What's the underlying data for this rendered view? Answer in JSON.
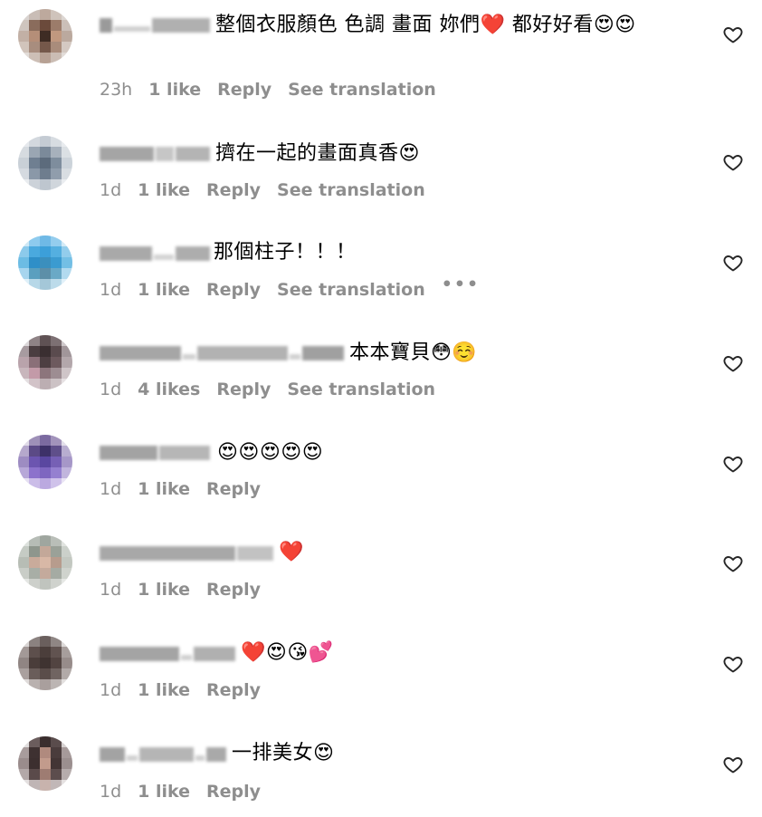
{
  "labels": {
    "reply": "Reply",
    "see_translation": "See translation"
  },
  "comments": [
    {
      "text": "整個衣服顏色 色調 畫面 妳們❤️ 都好好看😍😍",
      "time": "23h",
      "likes": "1 like",
      "show_translation": true,
      "show_more": false
    },
    {
      "text": "擠在一起的畫面真香😍",
      "time": "1d",
      "likes": "1 like",
      "show_translation": true,
      "show_more": false
    },
    {
      "text": "那個柱子！！！",
      "time": "1d",
      "likes": "1 like",
      "show_translation": true,
      "show_more": true,
      "more_label": "•••"
    },
    {
      "text": "本本寶貝😳☺️",
      "time": "1d",
      "likes": "4 likes",
      "show_translation": true,
      "show_more": false
    },
    {
      "text": "😍😍😍😍😍",
      "time": "1d",
      "likes": "1 like",
      "show_translation": false,
      "show_more": false
    },
    {
      "text": "❤️",
      "time": "1d",
      "likes": "1 like",
      "show_translation": false,
      "show_more": false
    },
    {
      "text": "❤️😍😘💕",
      "time": "1d",
      "likes": "1 like",
      "show_translation": false,
      "show_more": false
    },
    {
      "text": "一排美女😍",
      "time": "1d",
      "likes": "1 like",
      "show_translation": false,
      "show_more": false
    }
  ],
  "icons": {
    "like": "heart-outline-icon",
    "avatar": "blurred-avatar"
  },
  "colors": {
    "meta_text": "#8e8e8e",
    "comment_text": "#000000",
    "heart_stroke": "#262626"
  }
}
